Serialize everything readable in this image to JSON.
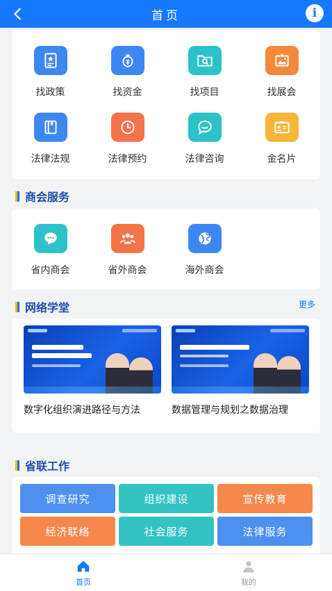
{
  "header": {
    "title": "首页"
  },
  "quick": {
    "items": [
      {
        "label": "找政策",
        "icon": "policy-icon",
        "color": "#3d87f5"
      },
      {
        "label": "找资金",
        "icon": "money-bag-icon",
        "color": "#3d87f5"
      },
      {
        "label": "找项目",
        "icon": "folder-search-icon",
        "color": "#2cc2c7"
      },
      {
        "label": "找展会",
        "icon": "exhibition-icon",
        "color": "#f5883a"
      },
      {
        "label": "法律法规",
        "icon": "law-book-icon",
        "color": "#3d87f5"
      },
      {
        "label": "法律预约",
        "icon": "clock-icon",
        "color": "#f5734a"
      },
      {
        "label": "法律咨询",
        "icon": "chat-icon",
        "color": "#2cc2c7"
      },
      {
        "label": "金名片",
        "icon": "business-card-icon",
        "color": "#f7b53a"
      }
    ]
  },
  "chamber": {
    "title": "商会服务",
    "items": [
      {
        "label": "省内商会",
        "icon": "chat-bubble-icon",
        "color": "#2cc2c7"
      },
      {
        "label": "省外商会",
        "icon": "group-icon",
        "color": "#f5734a"
      },
      {
        "label": "海外商会",
        "icon": "globe-icon",
        "color": "#3d87f5"
      }
    ]
  },
  "school": {
    "title": "网络学堂",
    "more": "更多",
    "courses": [
      {
        "caption": "数字化组织演进路径与方法"
      },
      {
        "caption": "数据管理与规划之数据治理"
      }
    ]
  },
  "work": {
    "title": "省联工作",
    "buttons": [
      {
        "label": "调查研究",
        "color": "#4d90ef"
      },
      {
        "label": "组织建设",
        "color": "#33c3c3"
      },
      {
        "label": "宣传教育",
        "color": "#f5884a"
      },
      {
        "label": "经济联络",
        "color": "#f5884a"
      },
      {
        "label": "社会服务",
        "color": "#33c3c3"
      },
      {
        "label": "法律服务",
        "color": "#4d90ef"
      }
    ]
  },
  "tabbar": {
    "tabs": [
      {
        "label": "首页",
        "icon": "home-icon",
        "active": true
      },
      {
        "label": "我的",
        "icon": "user-icon",
        "active": false
      }
    ]
  },
  "colors": {
    "primary": "#1677ff",
    "section_title": "#1f4fa8"
  }
}
